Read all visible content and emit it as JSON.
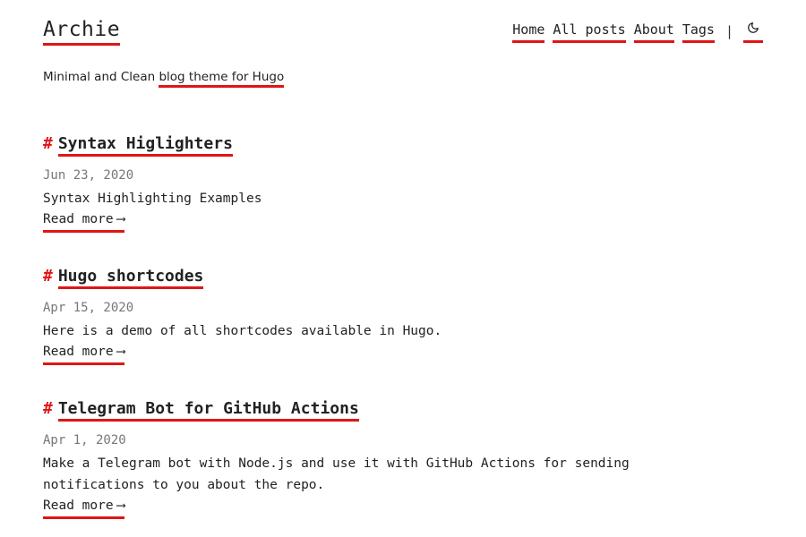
{
  "header": {
    "site_title": "Archie",
    "nav": [
      {
        "label": "Home"
      },
      {
        "label": "All posts"
      },
      {
        "label": "About"
      },
      {
        "label": "Tags"
      }
    ],
    "separator": "|",
    "theme_toggle_icon": "moon-icon"
  },
  "tagline": {
    "prefix": "Minimal and Clean ",
    "link": "blog theme for Hugo"
  },
  "posts": [
    {
      "hash": "#",
      "title": "Syntax Higlighters",
      "date": "Jun 23, 2020",
      "summary": "Syntax Highlighting Examples",
      "read_more": "Read more",
      "arrow": "⟶"
    },
    {
      "hash": "#",
      "title": "Hugo shortcodes",
      "date": "Apr 15, 2020",
      "summary": "Here is a demo of all shortcodes available in Hugo.",
      "read_more": "Read more",
      "arrow": "⟶"
    },
    {
      "hash": "#",
      "title": "Telegram Bot for GitHub Actions",
      "date": "Apr 1, 2020",
      "summary": "Make a Telegram bot with Node.js and use it with GitHub Actions for sending notifications to you about the repo.",
      "read_more": "Read more",
      "arrow": "⟶"
    }
  ],
  "colors": {
    "accent": "#e01515",
    "text": "#222222",
    "date": "#777777"
  }
}
